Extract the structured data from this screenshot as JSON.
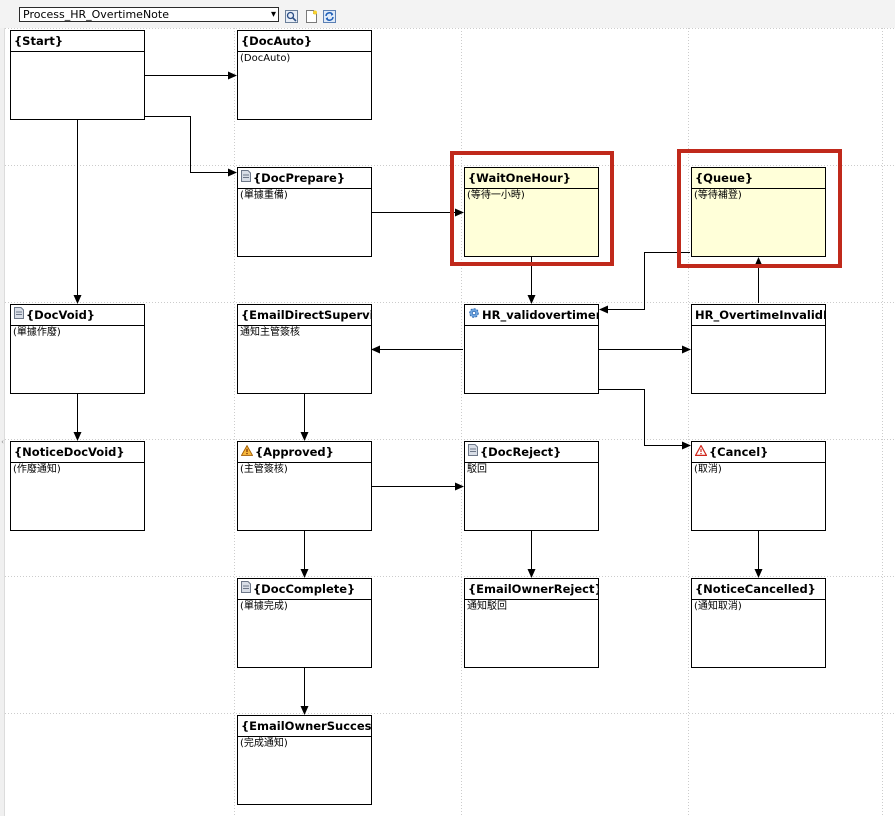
{
  "toolbar": {
    "process_select": "Process_HR_OvertimeNote"
  },
  "nodes": {
    "start": {
      "title": "{Start}",
      "desc": ""
    },
    "docauto": {
      "title": "{DocAuto}",
      "desc": "(DocAuto)"
    },
    "docprepare": {
      "title": "{DocPrepare}",
      "desc": "(單據重備)"
    },
    "waitonehour": {
      "title": "{WaitOneHour}",
      "desc": "(等待一小時)"
    },
    "queue": {
      "title": "{Queue}",
      "desc": "(等待補登)"
    },
    "docvoid": {
      "title": "{DocVoid}",
      "desc": "(單據作廢)"
    },
    "emaildirectsupervis": {
      "title": "{EmailDirectSupervis",
      "desc": "通知主管簽核"
    },
    "hr_validovertime": {
      "title": "HR_validovertimen",
      "desc": ""
    },
    "hr_overtimeinvalid": {
      "title": "HR_OvertimeInvalidN",
      "desc": ""
    },
    "noticedocvoid": {
      "title": "{NoticeDocVoid}",
      "desc": "(作廢通知)"
    },
    "approved": {
      "title": "{Approved}",
      "desc": "(主管簽核)"
    },
    "docreject": {
      "title": "{DocReject}",
      "desc": "駁回"
    },
    "cancel": {
      "title": "{Cancel}",
      "desc": "(取消)"
    },
    "doccomplete": {
      "title": "{DocComplete}",
      "desc": "(單據完成)"
    },
    "emailownerreject": {
      "title": "{EmailOwnerReject}",
      "desc": "通知駁回"
    },
    "noticecancelled": {
      "title": "{NoticeCancelled}",
      "desc": "(通知取消)"
    },
    "emailownersuccess": {
      "title": "{EmailOwnerSuccess",
      "desc": "(完成通知)"
    }
  },
  "colors": {
    "highlight": "#c0291b",
    "wait_node_fill": "#ffffd9",
    "grid": "#cccccc"
  }
}
